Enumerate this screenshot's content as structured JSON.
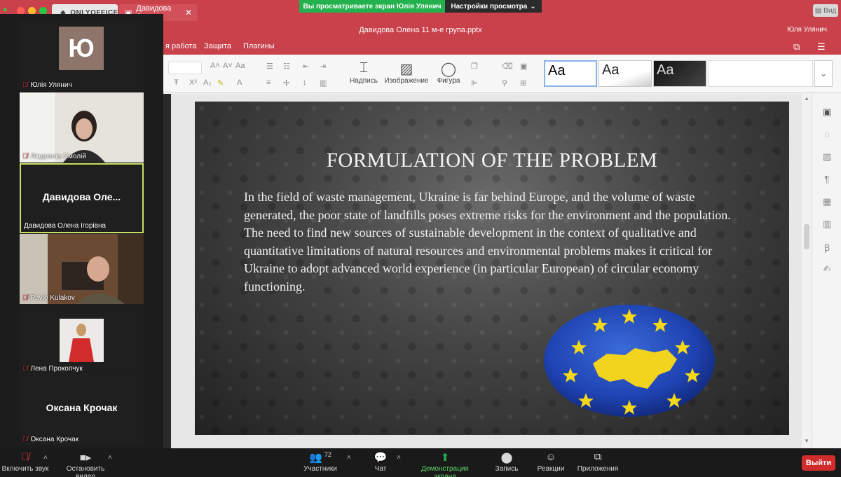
{
  "onlyoffice": {
    "logo_text": "ONLYOFFICE",
    "doc_tab_label": "Давидова Оле...",
    "doc_tab_close": "✕",
    "doc_title": "Давидова Олена 11 м-е група.pptx",
    "user_name": "Юля Улянич",
    "view_label": "Вид",
    "menu": [
      "я работа",
      "Защита",
      "Плагины"
    ],
    "toolbar": {
      "insert_text": "Надпись",
      "insert_image": "Изображение",
      "insert_shape": "Фигура",
      "themes": [
        "Aa",
        "Aa",
        "Aa"
      ]
    }
  },
  "share_banner": {
    "viewing": "Вы просматриваете экран Юлія Улянич",
    "view_settings": "Настройки просмотра"
  },
  "slide": {
    "title": "FORMULATION OF THE PROBLEM",
    "body": "In the field of waste management, Ukraine is far behind Europe, and the volume of waste generated, the poor state of landfills poses extreme risks for the environment and the population. The need to find new sources of sustainable development in the context of qualitative and quantitative limitations of natural resources and environmental problems makes it critical for Ukraine to adopt advanced world experience (in particular European) of circular economy functioning."
  },
  "participants_video": [
    {
      "name": "Юлія Улянич",
      "avatar_letter": "Ю",
      "type": "avatar"
    },
    {
      "name": "Людмила Смолій",
      "type": "camera"
    },
    {
      "name": "Давидова Олена Ігорівна",
      "display": "Давидова  Оле...",
      "type": "name",
      "active": true
    },
    {
      "name": "Pavlo Kulakov",
      "type": "camera"
    },
    {
      "name": "Лена Прокопчук",
      "type": "camera"
    },
    {
      "name": "Оксана Крочак",
      "display": "Оксана Крочак",
      "type": "name"
    }
  ],
  "zoom_bar": {
    "unmute": "Включить звук",
    "stop_video": "Остановить видео",
    "participants": "Участники",
    "participants_count": "72",
    "chat": "Чат",
    "share_screen": "Демонстрация экрана",
    "record": "Запись",
    "reactions": "Реакции",
    "apps": "Приложения",
    "leave": "Выйти"
  },
  "colors": {
    "onlyoffice_red": "#c8414b",
    "zoom_green": "#23b14d",
    "leave_red": "#d12c2c",
    "active_speaker": "#c7e065"
  }
}
